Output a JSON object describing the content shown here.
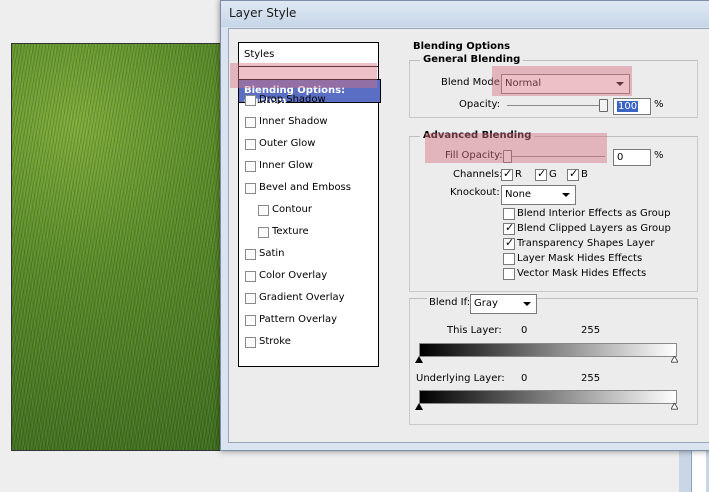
{
  "window": {
    "title": "Layer Style"
  },
  "styles_panel": {
    "header": "Styles",
    "selected": "Blending Options: Custom",
    "items": [
      {
        "label": "Drop Shadow",
        "checked": false,
        "indent": false
      },
      {
        "label": "Inner Shadow",
        "checked": false,
        "indent": false
      },
      {
        "label": "Outer Glow",
        "checked": false,
        "indent": false
      },
      {
        "label": "Inner Glow",
        "checked": false,
        "indent": false
      },
      {
        "label": "Bevel and Emboss",
        "checked": false,
        "indent": false
      },
      {
        "label": "Contour",
        "checked": false,
        "indent": true
      },
      {
        "label": "Texture",
        "checked": false,
        "indent": true
      },
      {
        "label": "Satin",
        "checked": false,
        "indent": false
      },
      {
        "label": "Color Overlay",
        "checked": false,
        "indent": false
      },
      {
        "label": "Gradient Overlay",
        "checked": false,
        "indent": false
      },
      {
        "label": "Pattern Overlay",
        "checked": false,
        "indent": false
      },
      {
        "label": "Stroke",
        "checked": false,
        "indent": false
      }
    ]
  },
  "blending": {
    "section_title": "Blending Options",
    "general": {
      "title": "General Blending",
      "blend_mode_label": "Blend Mode:",
      "blend_mode_value": "Normal",
      "opacity_label": "Opacity:",
      "opacity_value": "100",
      "opacity_unit": "%"
    },
    "advanced": {
      "title": "Advanced Blending",
      "fill_opacity_label": "Fill Opacity:",
      "fill_opacity_value": "0",
      "fill_opacity_unit": "%",
      "channels_label": "Channels:",
      "channels": [
        {
          "label": "R",
          "checked": true
        },
        {
          "label": "G",
          "checked": true
        },
        {
          "label": "B",
          "checked": true
        }
      ],
      "knockout_label": "Knockout:",
      "knockout_value": "None",
      "options": [
        {
          "label": "Blend Interior Effects as Group",
          "checked": false
        },
        {
          "label": "Blend Clipped Layers as Group",
          "checked": true
        },
        {
          "label": "Transparency Shapes Layer",
          "checked": true
        },
        {
          "label": "Layer Mask Hides Effects",
          "checked": false
        },
        {
          "label": "Vector Mask Hides Effects",
          "checked": false
        }
      ]
    },
    "blend_if": {
      "label": "Blend If:",
      "value": "Gray",
      "this_layer_label": "This Layer:",
      "this_layer_low": "0",
      "this_layer_high": "255",
      "underlying_label": "Underlying Layer:",
      "underlying_low": "0",
      "underlying_high": "255"
    }
  },
  "colors": {
    "selection": "#5a6fc4",
    "highlight": "#d67080",
    "dialog_bg": "#ececec"
  }
}
